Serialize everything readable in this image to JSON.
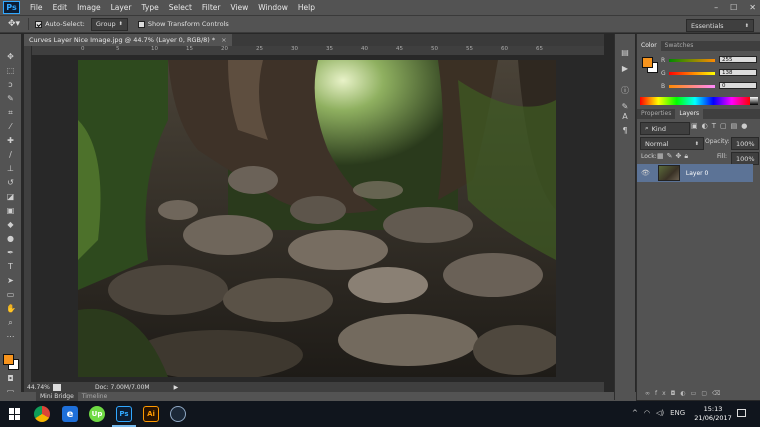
{
  "app": {
    "logo": "Ps",
    "menu": [
      "File",
      "Edit",
      "Image",
      "Layer",
      "Type",
      "Select",
      "Filter",
      "View",
      "Window",
      "Help"
    ],
    "window_controls": [
      "–",
      "☐",
      "✕"
    ]
  },
  "options_bar": {
    "auto_select_label": "Auto-Select:",
    "auto_select_value": "Group",
    "transform_label": "Show Transform Controls",
    "workspace": "Essentials"
  },
  "document": {
    "tab_title": "Curves Layer Nice Image.jpg @ 44.7% (Layer 0, RGB/8) *",
    "ruler_ticks": [
      "0",
      "5",
      "10",
      "15",
      "20",
      "25",
      "30",
      "35",
      "40",
      "45",
      "50",
      "55",
      "60",
      "65"
    ],
    "zoom": "44.74%",
    "doc_info": "Doc: 7.00M/7.00M"
  },
  "bottom_tabs": [
    "Mini Bridge",
    "Timeline"
  ],
  "color_panel": {
    "tabs": [
      "Color",
      "Swatches"
    ],
    "foreground": "#f7941d",
    "background": "#ffffff",
    "r_label": "R",
    "g_label": "G",
    "b_label": "B",
    "r": "255",
    "g": "138",
    "b": "0"
  },
  "layers_panel": {
    "tabs": [
      "Properties",
      "Layers"
    ],
    "filter": "Kind",
    "blend_mode": "Normal",
    "opacity_label": "Opacity:",
    "opacity": "100%",
    "lock_label": "Lock:",
    "fill_label": "Fill:",
    "fill": "100%",
    "layers": [
      {
        "name": "Layer 0"
      }
    ]
  },
  "taskbar": {
    "language": "ENG",
    "time": "15:13",
    "date": "21/06/2017",
    "apps": [
      {
        "name": "Chrome",
        "label": "",
        "color": "#db4437"
      },
      {
        "name": "Edge",
        "label": "e",
        "color": "#1e6fd9"
      },
      {
        "name": "Upwork",
        "label": "Up",
        "color": "#6fda44"
      },
      {
        "name": "Photoshop",
        "label": "Ps",
        "color": "#0c1d33"
      },
      {
        "name": "Illustrator",
        "label": "Ai",
        "color": "#2b1400"
      },
      {
        "name": "Steam",
        "label": "",
        "color": "#1b2838"
      }
    ]
  }
}
